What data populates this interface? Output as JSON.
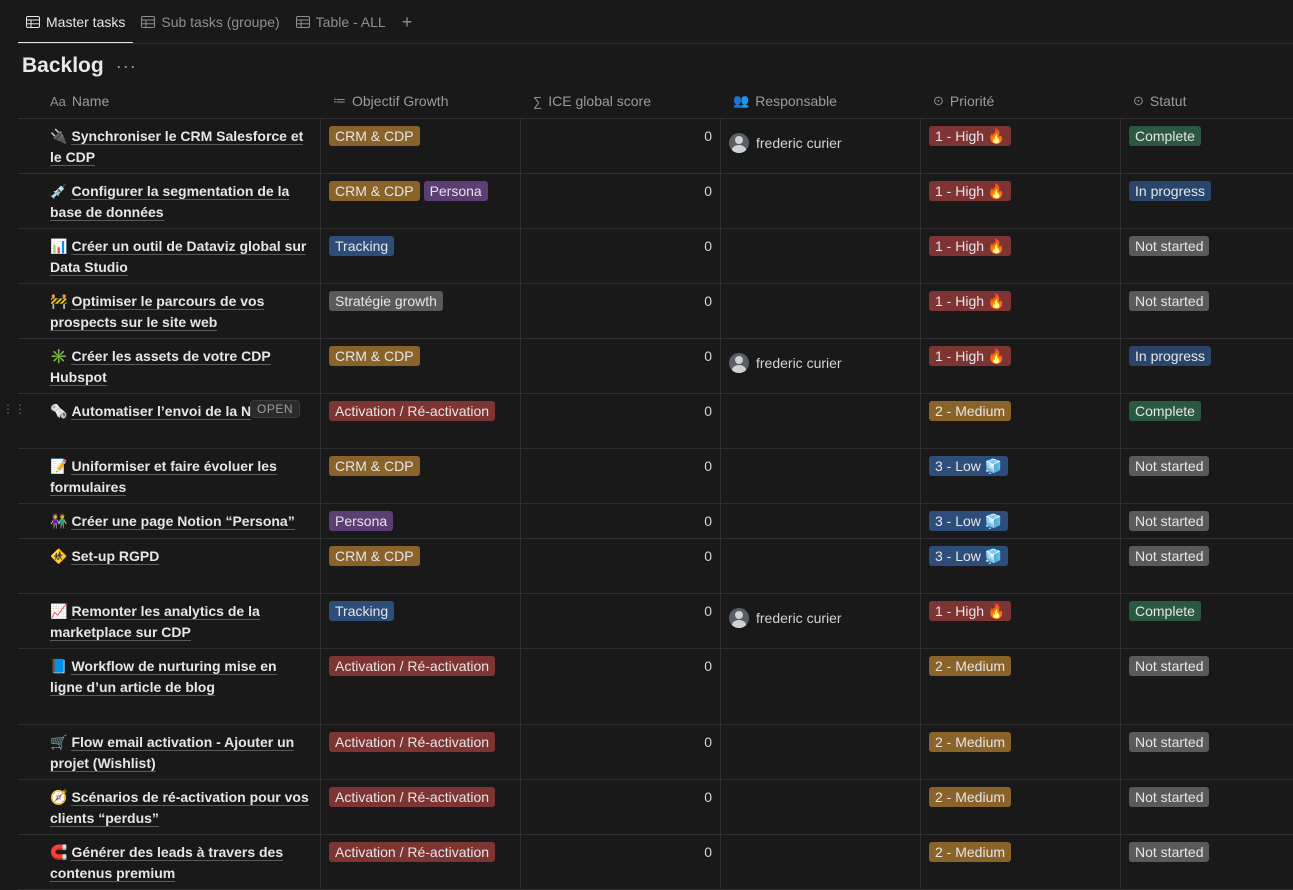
{
  "tabs": [
    {
      "label": "Master tasks",
      "active": true
    },
    {
      "label": "Sub tasks (groupe)",
      "active": false
    },
    {
      "label": "Table - ALL",
      "active": false
    }
  ],
  "page_title": "Backlog",
  "more_label": "···",
  "columns": {
    "name": "Name",
    "name_icon": "Aa",
    "objectif": "Objectif Growth",
    "objectif_icon": "≔",
    "ice": "ICE global score",
    "ice_icon": "∑",
    "responsable": "Responsable",
    "responsable_icon": "👥",
    "priorite": "Priorité",
    "priorite_icon": "⊙",
    "statut": "Statut",
    "statut_icon": "⊙"
  },
  "open_label": "OPEN",
  "colors": {
    "tag_brown": "#89632a",
    "tag_purple": "#5a3e74",
    "tag_blue": "#2d4d7a",
    "tag_gray": "#5a5a5a",
    "tag_red": "#7d3433",
    "status_green": "#2b593f",
    "status_blue": "#29456b",
    "status_gray": "#5a5a5a",
    "prio_red": "#7d3433",
    "prio_brown": "#89632a",
    "prio_blue": "#2d4d7a"
  },
  "rows": [
    {
      "emoji": "🔌",
      "name": "Synchroniser le CRM Salesforce et le CDP",
      "tags": [
        {
          "label": "CRM & CDP",
          "color": "tag_brown"
        }
      ],
      "score": "0",
      "responsable": "frederic curier",
      "priorite": {
        "label": "1 - High 🔥",
        "color": "prio_red"
      },
      "statut": {
        "label": "Complete",
        "color": "status_green"
      },
      "height": 54
    },
    {
      "emoji": "💉",
      "name": "Configurer la segmentation de la base de données",
      "tags": [
        {
          "label": "CRM & CDP",
          "color": "tag_brown"
        },
        {
          "label": "Persona",
          "color": "tag_purple"
        }
      ],
      "score": "0",
      "responsable": "",
      "priorite": {
        "label": "1 - High 🔥",
        "color": "prio_red"
      },
      "statut": {
        "label": "In progress",
        "color": "status_blue"
      },
      "height": 54
    },
    {
      "emoji": "📊",
      "name": "Créer un outil de Dataviz global sur Data Studio",
      "tags": [
        {
          "label": "Tracking",
          "color": "tag_blue"
        }
      ],
      "score": "0",
      "responsable": "",
      "priorite": {
        "label": "1 - High 🔥",
        "color": "prio_red"
      },
      "statut": {
        "label": "Not started",
        "color": "status_gray"
      },
      "height": 54
    },
    {
      "emoji": "🚧",
      "name": "Optimiser le parcours de vos prospects sur le site web",
      "tags": [
        {
          "label": "Stratégie growth",
          "color": "tag_gray"
        }
      ],
      "score": "0",
      "responsable": "",
      "priorite": {
        "label": "1 - High 🔥",
        "color": "prio_red"
      },
      "statut": {
        "label": "Not started",
        "color": "status_gray"
      },
      "height": 54
    },
    {
      "emoji": "✳️",
      "name": "Créer les assets de votre CDP Hubspot",
      "tags": [
        {
          "label": "CRM & CDP",
          "color": "tag_brown"
        }
      ],
      "score": "0",
      "responsable": "frederic curier",
      "priorite": {
        "label": "1 - High 🔥",
        "color": "prio_red"
      },
      "statut": {
        "label": "In progress",
        "color": "status_blue"
      },
      "height": 54
    },
    {
      "emoji": "🗞️",
      "name": "Automatiser l’envoi de la N",
      "tags": [
        {
          "label": "Activation / Ré-activation",
          "color": "tag_red"
        }
      ],
      "score": "0",
      "responsable": "",
      "priorite": {
        "label": "2 - Medium",
        "color": "prio_brown"
      },
      "statut": {
        "label": "Complete",
        "color": "status_green"
      },
      "height": 54,
      "open": true
    },
    {
      "emoji": "📝",
      "name": "Uniformiser et faire évoluer les formulaires",
      "tags": [
        {
          "label": "CRM & CDP",
          "color": "tag_brown"
        }
      ],
      "score": "0",
      "responsable": "",
      "priorite": {
        "label": "3 - Low 🧊",
        "color": "prio_blue"
      },
      "statut": {
        "label": "Not started",
        "color": "status_gray"
      },
      "height": 54
    },
    {
      "emoji": "👫",
      "name": "Créer une page Notion “Persona”",
      "tags": [
        {
          "label": "Persona",
          "color": "tag_purple"
        }
      ],
      "score": "0",
      "responsable": "",
      "priorite": {
        "label": "3 - Low 🧊",
        "color": "prio_blue"
      },
      "statut": {
        "label": "Not started",
        "color": "status_gray"
      },
      "height": 34
    },
    {
      "emoji": "🚸",
      "name": "Set-up RGPD",
      "tags": [
        {
          "label": "CRM & CDP",
          "color": "tag_brown"
        }
      ],
      "score": "0",
      "responsable": "",
      "priorite": {
        "label": "3 - Low 🧊",
        "color": "prio_blue"
      },
      "statut": {
        "label": "Not started",
        "color": "status_gray"
      },
      "height": 54
    },
    {
      "emoji": "📈",
      "name": "Remonter les analytics de la marketplace sur CDP",
      "tags": [
        {
          "label": "Tracking",
          "color": "tag_blue"
        }
      ],
      "score": "0",
      "responsable": "frederic curier",
      "priorite": {
        "label": "1 - High 🔥",
        "color": "prio_red"
      },
      "statut": {
        "label": "Complete",
        "color": "status_green"
      },
      "height": 54
    },
    {
      "emoji": "📘",
      "name": "Workflow de nurturing mise en ligne d’un article de blog",
      "tags": [
        {
          "label": "Activation / Ré-activation",
          "color": "tag_red"
        }
      ],
      "score": "0",
      "responsable": "",
      "priorite": {
        "label": "2 - Medium",
        "color": "prio_brown"
      },
      "statut": {
        "label": "Not started",
        "color": "status_gray"
      },
      "height": 75
    },
    {
      "emoji": "🛒",
      "name": "Flow email activation - Ajouter un projet (Wishlist)",
      "tags": [
        {
          "label": "Activation / Ré-activation",
          "color": "tag_red"
        }
      ],
      "score": "0",
      "responsable": "",
      "priorite": {
        "label": "2 - Medium",
        "color": "prio_brown"
      },
      "statut": {
        "label": "Not started",
        "color": "status_gray"
      },
      "height": 54
    },
    {
      "emoji": "🧭",
      "name": "Scénarios de ré-activation pour vos clients “perdus”",
      "tags": [
        {
          "label": "Activation / Ré-activation",
          "color": "tag_red"
        }
      ],
      "score": "0",
      "responsable": "",
      "priorite": {
        "label": "2 - Medium",
        "color": "prio_brown"
      },
      "statut": {
        "label": "Not started",
        "color": "status_gray"
      },
      "height": 54
    },
    {
      "emoji": "🧲",
      "name": "Générer des leads à travers des contenus premium",
      "tags": [
        {
          "label": "Activation / Ré-activation",
          "color": "tag_red"
        }
      ],
      "score": "0",
      "responsable": "",
      "priorite": {
        "label": "2 - Medium",
        "color": "prio_brown"
      },
      "statut": {
        "label": "Not started",
        "color": "status_gray"
      },
      "height": 54
    }
  ]
}
